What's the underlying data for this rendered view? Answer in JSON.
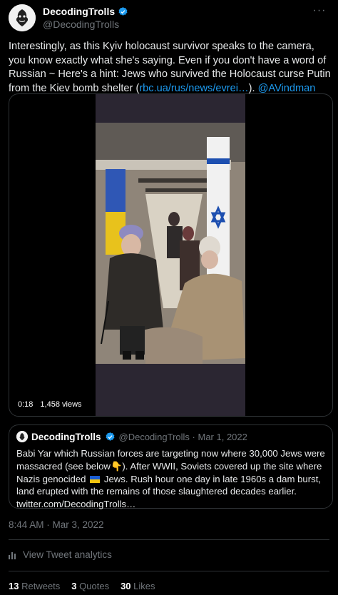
{
  "header": {
    "display_name": "DecodingTrolls",
    "handle": "@DecodingTrolls",
    "verified_icon": "verified-badge-icon",
    "more_icon": "more-horizontal-icon"
  },
  "tweet": {
    "text_before_link": "Interestingly, as this Kyiv holocaust survivor speaks to the camera, you know exactly what she's saying. Even if you don't have a word of Russian ~ Here's a hint: Jews who survived the Holocaust curse Putin from the Kiev bomb shelter (",
    "link": "rbc.ua/rus/news/evrei…",
    "text_after_link": "). ",
    "mention": "@AVindman"
  },
  "video": {
    "time": "0:18",
    "views": "1,458 views"
  },
  "quote": {
    "display_name": "DecodingTrolls",
    "handle_date": "@DecodingTrolls · Mar 1, 2022",
    "text_part1": "Babi Yar which Russian forces are targeting now where 30,000 Jews were massacred (see below",
    "emoji_point": "👇",
    "text_part2": "). After WWII, Soviets covered up the site where Nazis genocided",
    "text_part3": "Jews. Rush hour one day in late 1960s a dam burst, land erupted with the remains of those slaughtered decades earlier.",
    "link": "twitter.com/DecodingTrolls…"
  },
  "timestamp": "8:44 AM · Mar 3, 2022",
  "analytics": {
    "label": "View Tweet analytics",
    "icon": "analytics-bars-icon"
  },
  "stats": {
    "retweets_count": "13",
    "retweets_label": "Retweets",
    "quotes_count": "3",
    "quotes_label": "Quotes",
    "likes_count": "30",
    "likes_label": "Likes"
  },
  "colors": {
    "accent": "#1d9bf0",
    "secondary_text": "#71767b",
    "border": "#2f3336"
  }
}
